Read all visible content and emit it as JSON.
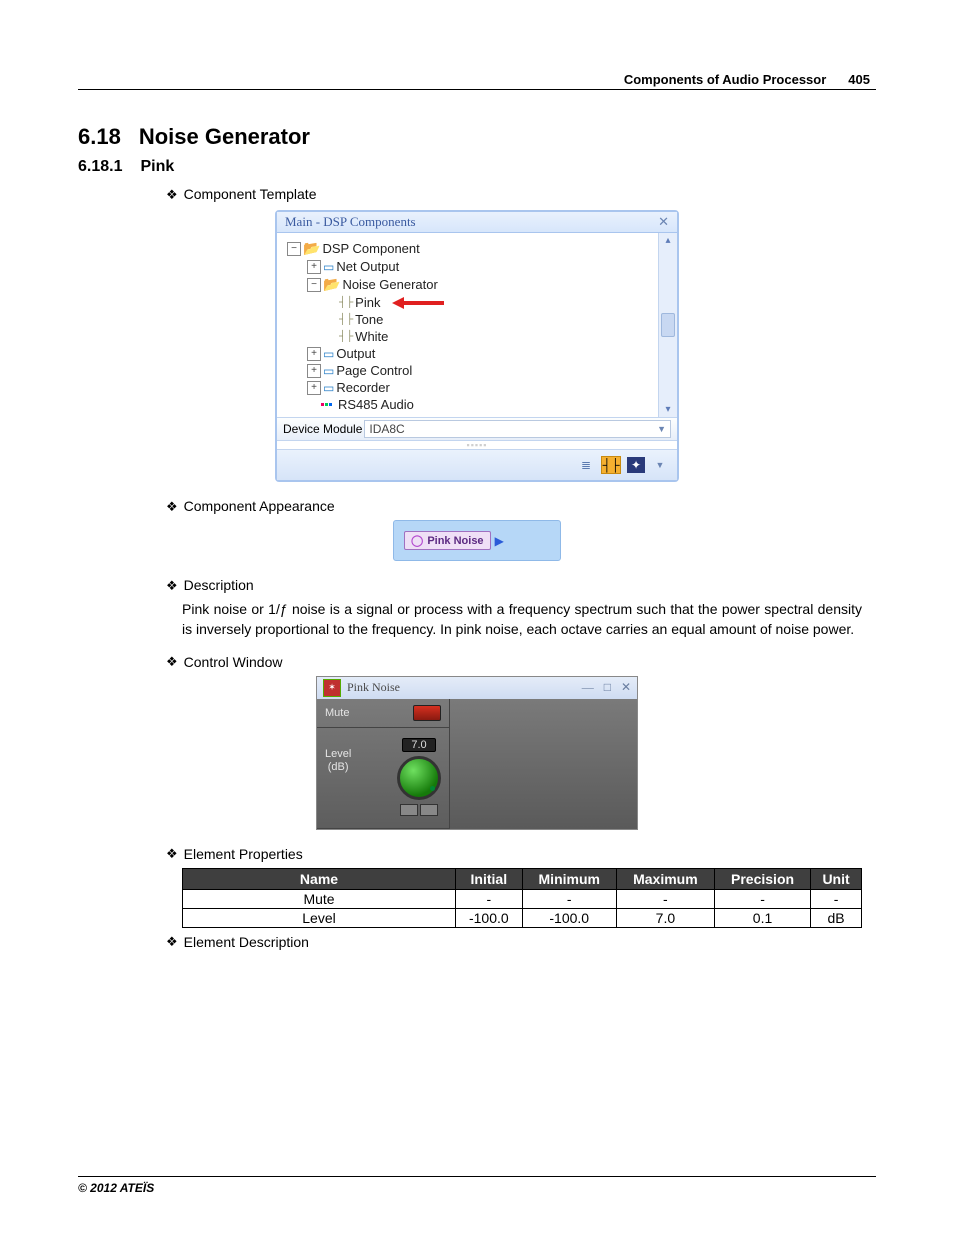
{
  "header": {
    "section": "Components of Audio Processor",
    "page": "405"
  },
  "h2": {
    "num": "6.18",
    "title": "Noise Generator"
  },
  "h3": {
    "num": "6.18.1",
    "title": "Pink"
  },
  "bullets": {
    "template": "Component Template",
    "appearance": "Component Appearance",
    "description": "Description",
    "control": "Control Window",
    "props": "Element Properties",
    "elemdesc": "Element Description"
  },
  "panel": {
    "title": "Main - DSP Components",
    "tree": {
      "root": "DSP Component",
      "net_output": "Net Output",
      "noise_gen": "Noise Generator",
      "pink": "Pink",
      "tone": "Tone",
      "white": "White",
      "output": "Output",
      "page_control": "Page Control",
      "recorder": "Recorder",
      "rs485": "RS485 Audio"
    },
    "device_module_label": "Device Module",
    "device_module_value": "IDA8C"
  },
  "chip": {
    "label": "Pink Noise"
  },
  "desc_text": "Pink noise or 1/ƒ noise is a signal or process with a frequency spectrum such that the power spectral density is inversely proportional to the frequency. In pink noise, each octave carries an equal amount of noise power.",
  "ctrl": {
    "title": "Pink Noise",
    "mute": "Mute",
    "level_label": "Level\n(dB)",
    "level_val": "7.0"
  },
  "table": {
    "headers": {
      "name": "Name",
      "initial": "Initial",
      "min": "Minimum",
      "max": "Maximum",
      "prec": "Precision",
      "unit": "Unit"
    },
    "rows": [
      {
        "name": "Mute",
        "initial": "-",
        "min": "-",
        "max": "-",
        "prec": "-",
        "unit": "-"
      },
      {
        "name": "Level",
        "initial": "-100.0",
        "min": "-100.0",
        "max": "7.0",
        "prec": "0.1",
        "unit": "dB"
      }
    ]
  },
  "footer": "© 2012 ATEÏS"
}
